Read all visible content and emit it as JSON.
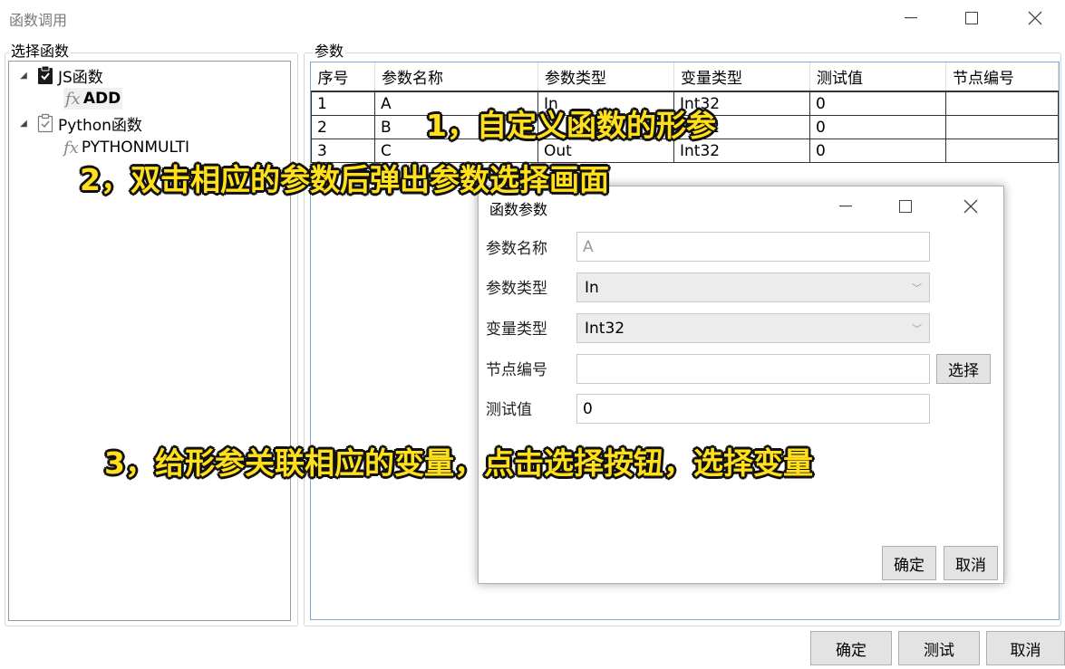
{
  "window": {
    "title": "函数调用",
    "colors": {
      "annotation": "#ffe01a",
      "grid_border": "#7aa7d6"
    }
  },
  "left_panel": {
    "label": "选择函数",
    "tree": [
      {
        "label": "JS函数",
        "icon": "clipboard-filled-icon",
        "children": [
          {
            "label": "ADD",
            "icon": "fx-icon",
            "selected": true
          }
        ]
      },
      {
        "label": "Python函数",
        "icon": "clipboard-outline-icon",
        "children": [
          {
            "label": "PYTHONMULTI",
            "icon": "fx-icon"
          }
        ]
      }
    ]
  },
  "params_panel": {
    "label": "参数",
    "columns": [
      "序号",
      "参数名称",
      "参数类型",
      "变量类型",
      "测试值",
      "节点编号"
    ],
    "rows": [
      [
        "1",
        "A",
        "In",
        "Int32",
        "0",
        ""
      ],
      [
        "2",
        "B",
        "In",
        "Int32",
        "0",
        ""
      ],
      [
        "3",
        "C",
        "Out",
        "Int32",
        "0",
        ""
      ]
    ]
  },
  "dialog": {
    "title": "函数参数",
    "fields": {
      "name_label": "参数名称",
      "name_value": "A",
      "ptype_label": "参数类型",
      "ptype_value": "In",
      "vtype_label": "变量类型",
      "vtype_value": "Int32",
      "node_label": "节点编号",
      "node_value": "",
      "test_label": "测试值",
      "test_value": "0"
    },
    "select_button": "选择",
    "ok_button": "确定",
    "cancel_button": "取消"
  },
  "footer": {
    "ok_button": "确定",
    "test_button": "测试",
    "cancel_button": "取消"
  },
  "annotations": {
    "note1": "1，自定义函数的形参",
    "note2": "2，双击相应的参数后弹出参数选择画面",
    "note3": "3，给形参关联相应的变量，点击选择按钮，选择变量"
  }
}
